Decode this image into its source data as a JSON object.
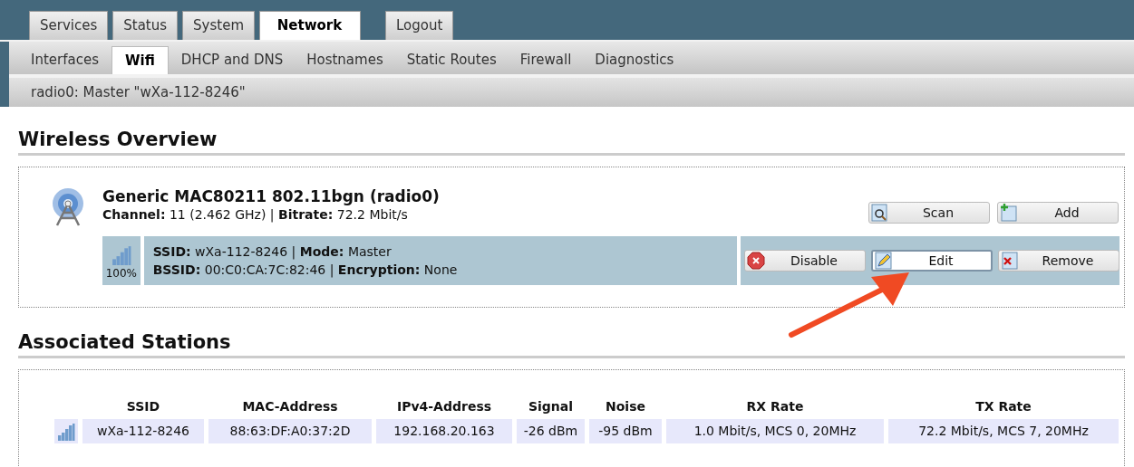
{
  "top_tabs": [
    {
      "label": "Services",
      "selected": false
    },
    {
      "label": "Status",
      "selected": false
    },
    {
      "label": "System",
      "selected": false
    },
    {
      "label": "Network",
      "selected": true
    },
    {
      "label": "Logout",
      "selected": false
    }
  ],
  "sub_tabs": [
    {
      "label": "Interfaces",
      "selected": false
    },
    {
      "label": "Wifi",
      "selected": true
    },
    {
      "label": "DHCP and DNS",
      "selected": false
    },
    {
      "label": "Hostnames",
      "selected": false
    },
    {
      "label": "Static Routes",
      "selected": false
    },
    {
      "label": "Firewall",
      "selected": false
    },
    {
      "label": "Diagnostics",
      "selected": false
    }
  ],
  "breadcrumb": "radio0: Master \"wXa-112-8246\"",
  "wireless_overview": {
    "heading": "Wireless Overview",
    "device": {
      "title": "Generic MAC80211 802.11bgn (radio0)",
      "details": "**Channel:** 11 (2.462 GHz) | **Bitrate:** 72.2 Mbit/s",
      "buttons": [
        {
          "kind": "scan",
          "label": "Scan",
          "focused": false
        },
        {
          "kind": "add",
          "label": "Add",
          "focused": false
        }
      ]
    },
    "networks": [
      {
        "signal": "100%",
        "line_1": "**SSID:** wXa-112-8246 | **Mode:** Master",
        "line_2": "**BSSID:** 00:C0:CA:7C:82:46 | **Encryption:** None",
        "buttons": [
          {
            "kind": "disable",
            "label": "Disable",
            "focused": false
          },
          {
            "kind": "edit",
            "label": "Edit",
            "focused": true
          },
          {
            "kind": "remove",
            "label": "Remove",
            "focused": false
          }
        ]
      }
    ]
  },
  "associated_stations": {
    "heading": "Associated Stations",
    "columns": [
      "SSID",
      "MAC-Address",
      "IPv4-Address",
      "Signal",
      "Noise",
      "RX Rate",
      "TX Rate"
    ],
    "rows": [
      [
        "wXa-112-8246",
        "88:63:DF:A0:37:2D",
        "192.168.20.163",
        "-26 dBm",
        "-95 dBm",
        "1.0 Mbit/s, MCS 0, 20MHz",
        "72.2 Mbit/s, MCS 7, 20MHz"
      ]
    ]
  }
}
